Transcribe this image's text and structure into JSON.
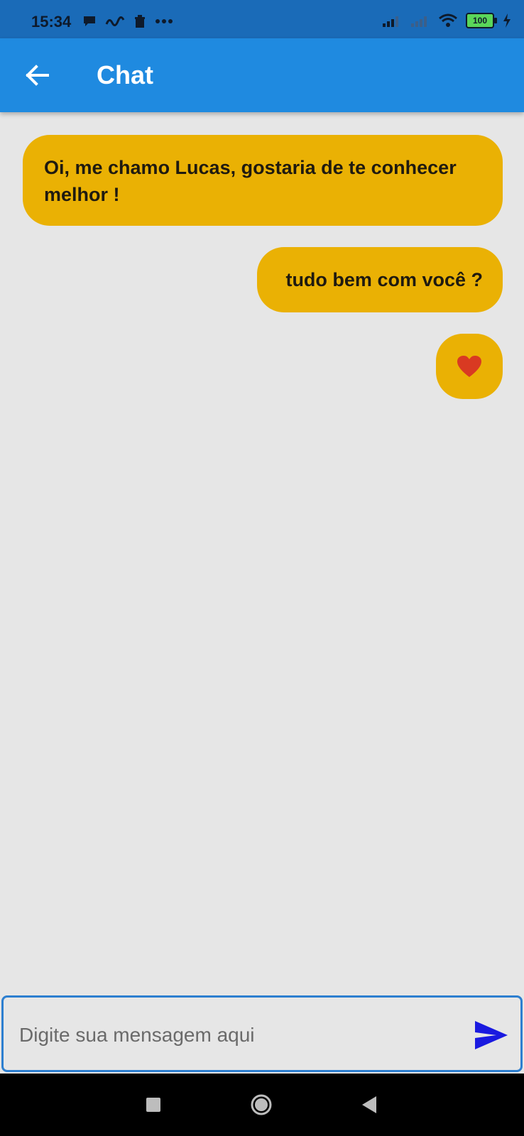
{
  "status_bar": {
    "time": "15:34",
    "battery_level": "100",
    "icons": [
      "message-icon",
      "ifood-icon",
      "trash-icon",
      "more-icon",
      "signal-icon",
      "signal-icon",
      "wifi-icon",
      "battery-icon",
      "charging-icon"
    ]
  },
  "app_bar": {
    "title": "Chat",
    "back_icon": "arrow-left-icon"
  },
  "messages": [
    {
      "text": "Oi, me chamo Lucas, gostaria de te conhecer melhor !"
    },
    {
      "text": "tudo bem com você ?"
    },
    {
      "text": "❤️"
    }
  ],
  "composer": {
    "placeholder": "Digite sua mensagem aqui",
    "value": "",
    "send_icon": "send-icon"
  },
  "colors": {
    "status_bar": "#1a6bb8",
    "app_bar": "#1f8ae0",
    "bubble": "#eab104",
    "background": "#e6e6e6",
    "input_border": "#2d7fd0",
    "send_icon": "#1a1ae0"
  },
  "nav_bar": {
    "icons": [
      "recents-icon",
      "home-icon",
      "back-icon"
    ]
  }
}
